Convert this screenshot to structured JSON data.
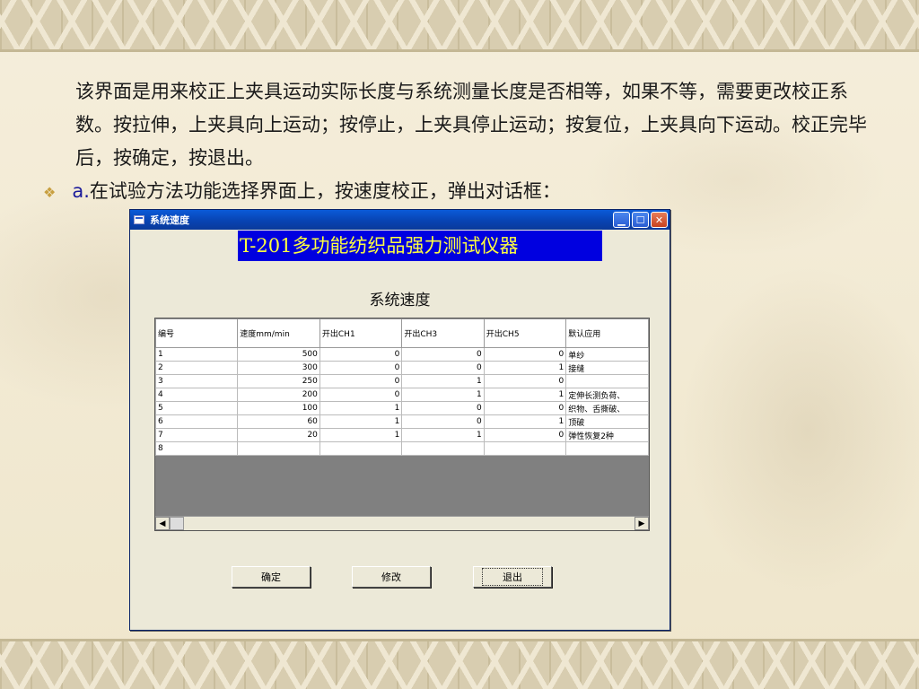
{
  "slide": {
    "paragraph": "该界面是用来校正上夹具运动实际长度与系统测量长度是否相等，如果不等，需要更改校正系数。按拉伸，上夹具向上运动；按停止，上夹具停止运动；按复位，上夹具向下运动。校正完毕后，按确定，按退出。",
    "bullet_prefix": "a.",
    "bullet_text": "在试验方法功能选择界面上，按速度校正，弹出对话框："
  },
  "dialog": {
    "title": "系统速度",
    "banner": "T-201多功能纺织品强力测试仪器",
    "heading": "系统速度",
    "grid": {
      "columns": [
        "编号",
        "速度mm/min",
        "开出CH1",
        "开出CH3",
        "开出CH5",
        "默认应用"
      ],
      "rows": [
        [
          "1",
          "500",
          "0",
          "0",
          "0",
          "单纱"
        ],
        [
          "2",
          "300",
          "0",
          "0",
          "1",
          "接缝"
        ],
        [
          "3",
          "250",
          "0",
          "1",
          "0",
          ""
        ],
        [
          "4",
          "200",
          "0",
          "1",
          "1",
          "定伸长测负荷、"
        ],
        [
          "5",
          "100",
          "1",
          "0",
          "0",
          "织物、舌撕破、"
        ],
        [
          "6",
          "60",
          "1",
          "0",
          "1",
          "顶破"
        ],
        [
          "7",
          "20",
          "1",
          "1",
          "0",
          "弹性恢复2种"
        ],
        [
          "8",
          "",
          "",
          "",
          "",
          ""
        ]
      ]
    },
    "buttons": {
      "ok": "确定",
      "modify": "修改",
      "exit": "退出"
    }
  }
}
